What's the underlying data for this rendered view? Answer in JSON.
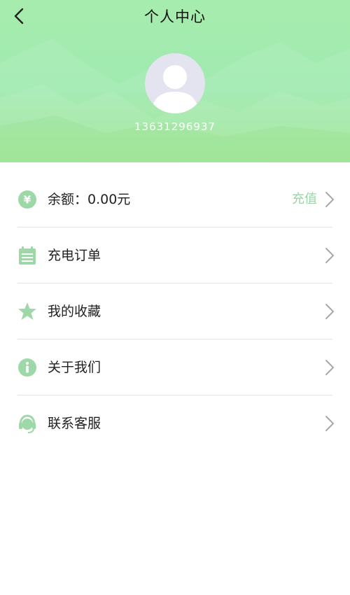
{
  "header": {
    "title": "个人中心",
    "back_icon": "chevron-left-icon",
    "phone": "13631296937",
    "avatar_icon": "default-user-avatar-icon",
    "bg_colors": [
      "#a6ecae",
      "#9be58f"
    ]
  },
  "menu": {
    "items": [
      {
        "label": "余额：0.00元",
        "icon": "yen-coin-icon",
        "action": "充值"
      },
      {
        "label": "充电订单",
        "icon": "calendar-list-icon"
      },
      {
        "label": "我的收藏",
        "icon": "star-icon"
      },
      {
        "label": "关于我们",
        "icon": "info-icon"
      },
      {
        "label": "联系客服",
        "icon": "headset-icon"
      }
    ]
  },
  "colors": {
    "icon_accent": "#9fd8a8",
    "action_text": "#9bd4a6",
    "chevron": "#a8a8a8"
  }
}
